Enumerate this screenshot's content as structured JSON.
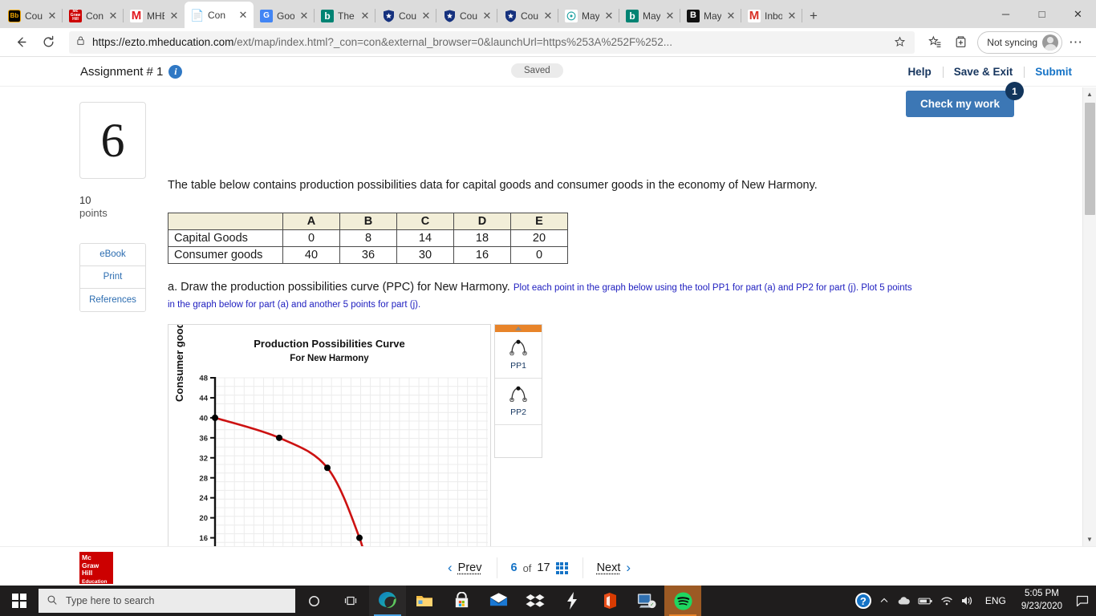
{
  "browser": {
    "tabs": [
      {
        "favicon": "blackboard-icon",
        "title": "Cou",
        "active": false
      },
      {
        "favicon": "mheducation-icon",
        "title": "Con",
        "active": false
      },
      {
        "favicon": "mcgraw-m-icon",
        "title": "MHE",
        "active": false
      },
      {
        "favicon": "document-icon",
        "title": "Con",
        "active": true
      },
      {
        "favicon": "google-translate-icon",
        "title": "Goo",
        "active": false
      },
      {
        "favicon": "bing-icon",
        "title": "The",
        "active": false
      },
      {
        "favicon": "shield-icon",
        "title": "Cou",
        "active": false
      },
      {
        "favicon": "shield-icon",
        "title": "Cou",
        "active": false
      },
      {
        "favicon": "shield-icon",
        "title": "Cou",
        "active": false
      },
      {
        "favicon": "quizlet-icon",
        "title": "May",
        "active": false
      },
      {
        "favicon": "bing-icon",
        "title": "May",
        "active": false
      },
      {
        "favicon": "brainly-icon",
        "title": "May",
        "active": false
      },
      {
        "favicon": "gmail-icon",
        "title": "Inbo",
        "active": false
      }
    ],
    "new_tab_label": "+",
    "window_controls": {
      "minimize": "─",
      "maximize": "□",
      "close": "✕"
    },
    "back_icon": "back-arrow-icon",
    "refresh_icon": "refresh-icon",
    "lock_icon": "lock-icon",
    "url_strong": "https://ezto.mheducation.com",
    "url_rest": "/ext/map/index.html?_con=con&external_browser=0&launchUrl=https%253A%252F%252...",
    "favorite_icon": "star-add-icon",
    "collections_icon": "favorites-list-icon",
    "collections2_icon": "collections-icon",
    "profile_label": "Not syncing",
    "more_icon": "ellipsis-icon"
  },
  "header": {
    "assignment_title": "Assignment # 1",
    "info_icon": "info-icon",
    "saved_label": "Saved",
    "links": [
      {
        "label": "Help",
        "style": "dark"
      },
      {
        "label": "Save & Exit",
        "style": "dark"
      },
      {
        "label": "Submit",
        "style": "blue"
      }
    ],
    "check_my_work_label": "Check my work",
    "check_my_work_badge": "1"
  },
  "rail": {
    "question_number": "6",
    "points_value": "10",
    "points_label": "points",
    "buttons": [
      "eBook",
      "Print",
      "References"
    ]
  },
  "question": {
    "prompt": "The table below contains production possibilities data for capital goods and consumer goods in the economy of New Harmony.",
    "table": {
      "corner": "",
      "columns": [
        "A",
        "B",
        "C",
        "D",
        "E"
      ],
      "rows": [
        {
          "label": "Capital Goods",
          "values": [
            "0",
            "8",
            "14",
            "18",
            "20"
          ]
        },
        {
          "label": "Consumer goods",
          "values": [
            "40",
            "36",
            "30",
            "16",
            "0"
          ]
        }
      ]
    },
    "part_a_main": "a.  Draw the production possibilities curve (PPC) for New Harmony.",
    "part_a_note": "Plot each point in the graph below using the tool PP1 for part (a) and PP2 for part (j). Plot 5 points in the graph below for part (a) and another 5 points for part (j)."
  },
  "chart_data": {
    "type": "line",
    "title": "Production Possibilities Curve",
    "subtitle": "For New Harmony",
    "xlabel": "",
    "ylabel": "Consumer goods",
    "yticks": [
      48,
      44,
      40,
      36,
      32,
      28,
      24,
      20,
      16
    ],
    "ylim": [
      14,
      48
    ],
    "xlim": [
      0,
      34
    ],
    "grid": true,
    "series": [
      {
        "name": "PPC",
        "color": "#cc1111",
        "x": [
          0,
          8,
          14,
          18
        ],
        "y": [
          40,
          36,
          30,
          16
        ]
      }
    ],
    "points": [
      {
        "x": 0,
        "y": 40
      },
      {
        "x": 8,
        "y": 36
      },
      {
        "x": 14,
        "y": 30
      },
      {
        "x": 18,
        "y": 16
      }
    ],
    "point_color": "#000000"
  },
  "palette": {
    "header_color": "#e8842a",
    "collapse_icon": "triangle-up-icon",
    "tools": [
      {
        "icon": "curve-tool-icon",
        "label": "PP1"
      },
      {
        "icon": "curve-tool-icon",
        "label": "PP2"
      }
    ]
  },
  "bottom_nav": {
    "logo_lines": [
      "Mc",
      "Graw",
      "Hill"
    ],
    "logo_sub": "Education",
    "prev_label": "Prev",
    "prev_icon": "chevron-left-icon",
    "current_page": "6",
    "of_label": "of",
    "total_pages": "17",
    "grid_icon": "grid-view-icon",
    "next_label": "Next",
    "next_icon": "chevron-right-icon"
  },
  "taskbar": {
    "start_icon": "windows-start-icon",
    "search_icon": "search-icon",
    "search_placeholder": "Type here to search",
    "cortana_icon": "cortana-icon",
    "taskview_icon": "task-view-icon",
    "apps": [
      "edge-icon",
      "file-explorer-icon",
      "microsoft-store-icon",
      "mail-icon",
      "dropbox-icon",
      "lightning-app-icon",
      "office-icon",
      "remote-desktop-icon",
      "spotify-icon"
    ],
    "tray": {
      "help_icon": "help-icon",
      "chevron_icon": "chevron-up-icon",
      "onedrive_icon": "onedrive-icon",
      "battery_icon": "battery-icon",
      "wifi_icon": "wifi-icon",
      "volume_icon": "volume-icon",
      "language": "ENG",
      "time": "5:05 PM",
      "date": "9/23/2020",
      "action_center_icon": "action-center-icon"
    }
  }
}
